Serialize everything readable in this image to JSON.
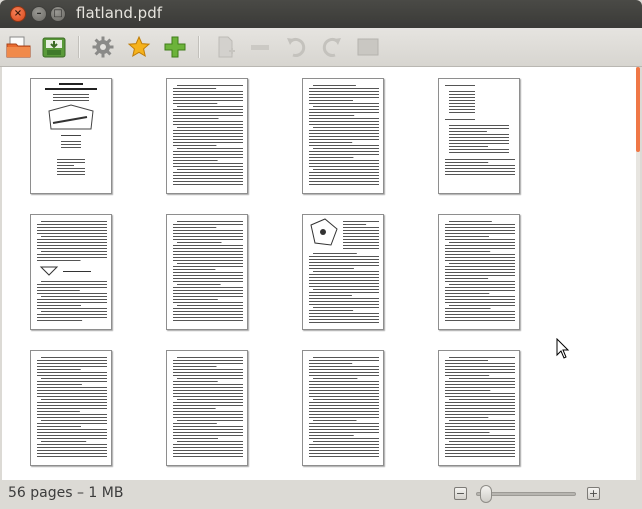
{
  "window": {
    "title": "flatland.pdf",
    "buttons": {
      "close": "×",
      "minimize": "–",
      "maximize": "□"
    }
  },
  "toolbar": {
    "items": [
      {
        "name": "open-icon",
        "enabled": true
      },
      {
        "name": "save-icon",
        "enabled": true
      },
      {
        "name": "gear-icon",
        "enabled": true
      },
      {
        "name": "star-icon",
        "enabled": true
      },
      {
        "name": "add-icon",
        "enabled": true
      },
      {
        "name": "new-page-icon",
        "enabled": false
      },
      {
        "name": "remove-icon",
        "enabled": false
      },
      {
        "name": "rotate-left-icon",
        "enabled": false
      },
      {
        "name": "rotate-right-icon",
        "enabled": false
      },
      {
        "name": "crop-icon",
        "enabled": false
      }
    ]
  },
  "pages": {
    "visible_count": 12,
    "columns": 4
  },
  "status": {
    "summary": "56 pages – 1 MB"
  },
  "zoom": {
    "minus_label": "−",
    "plus_label": "+",
    "level": 0.08
  },
  "colors": {
    "accent": "#f07746",
    "titlebar": "#3c3b37",
    "toolbar": "#dfddd8"
  }
}
